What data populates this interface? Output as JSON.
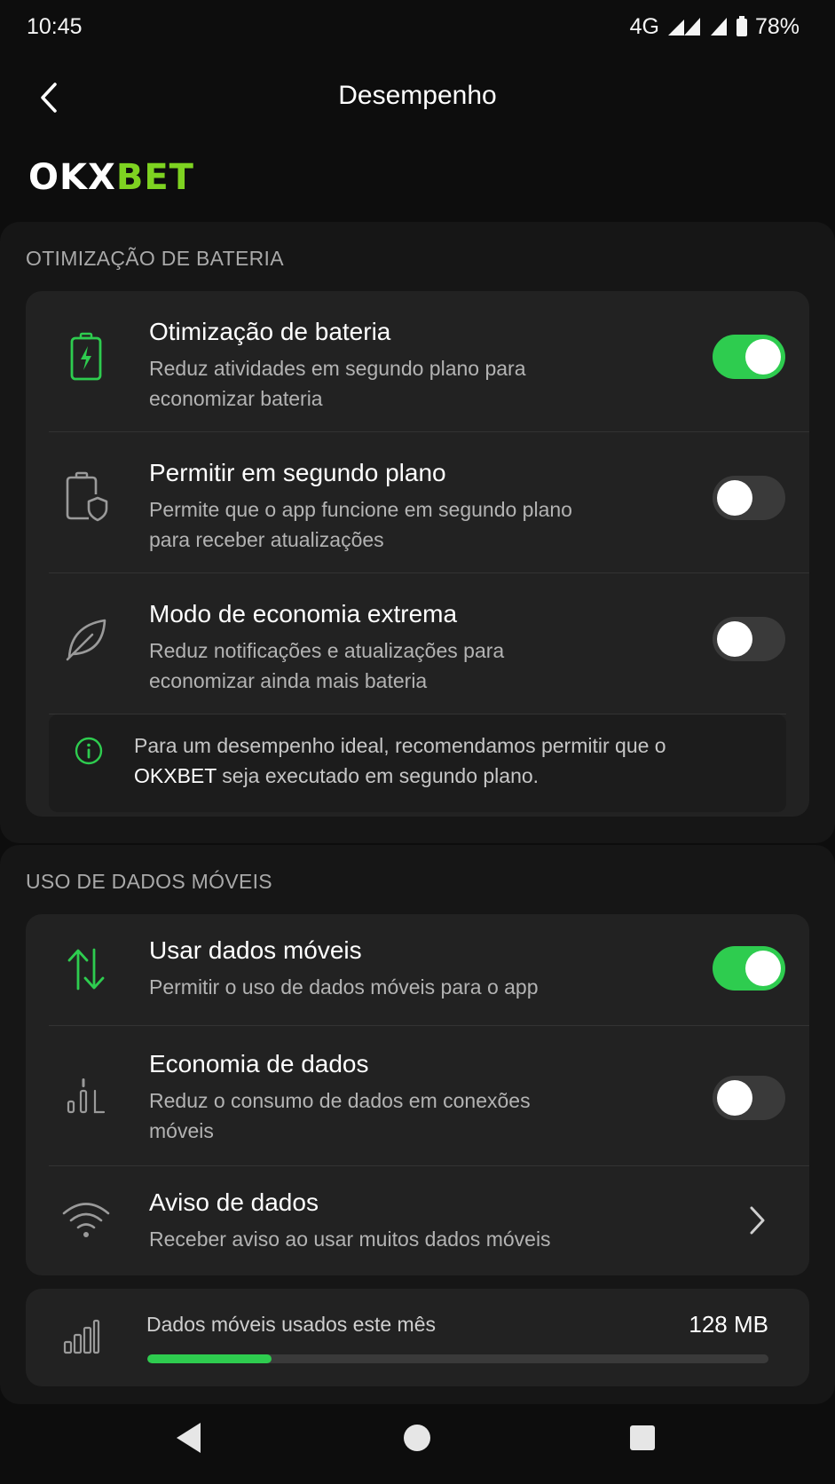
{
  "status_bar": {
    "time": "10:45",
    "network": "4G",
    "battery": "78%"
  },
  "header": {
    "title": "Desempenho",
    "back_icon": "chevron-left-icon"
  },
  "brand": {
    "part1": "OKX",
    "part2": "BET",
    "colors": {
      "white": "#ffffff",
      "green": "#7ed321"
    }
  },
  "battery_section": {
    "title": "OTIMIZAÇÃO DE BATERIA",
    "items": [
      {
        "icon": "battery-charging-icon",
        "title": "Otimização de bateria",
        "subtitle": "Reduz atividades em segundo plano para economizar bateria",
        "enabled": true
      },
      {
        "icon": "battery-shield-icon",
        "title": "Permitir em segundo plano",
        "subtitle": "Permite que o app funcione em segundo plano para receber atualizações",
        "enabled": false
      },
      {
        "icon": "leaf-icon",
        "title": "Modo de economia extrema",
        "subtitle": "Reduz notificações e atualizações para economizar ainda mais bateria",
        "enabled": false
      }
    ],
    "info": {
      "icon": "info-icon",
      "text_before": "Para um desempenho ideal, recomendamos permitir que o ",
      "brand": "OKXBET",
      "text_after": " seja executado em segundo plano."
    }
  },
  "data_section": {
    "title": "USO DE DADOS MÓVEIS",
    "items": [
      {
        "icon": "data-transfer-icon",
        "title": "Usar dados móveis",
        "subtitle": "Permitir o uso de dados móveis para o app",
        "enabled": true
      },
      {
        "icon": "data-saver-icon",
        "title": "Economia de dados",
        "subtitle": "Reduz o consumo de dados em conexões móveis",
        "enabled": false
      },
      {
        "icon": "wifi-icon",
        "title": "Aviso de dados",
        "subtitle": "Receber aviso ao usar muitos dados móveis",
        "action_icon": "chevron-right-icon"
      }
    ],
    "usage": {
      "icon": "signal-bars-icon",
      "label": "Dados móveis usados este mês",
      "value": "128 MB",
      "fraction": 0.2
    }
  },
  "nav": {
    "back": "nav-back-icon",
    "home": "nav-home-icon",
    "recents": "nav-recents-icon"
  },
  "accent_color": "#2ecc4f"
}
